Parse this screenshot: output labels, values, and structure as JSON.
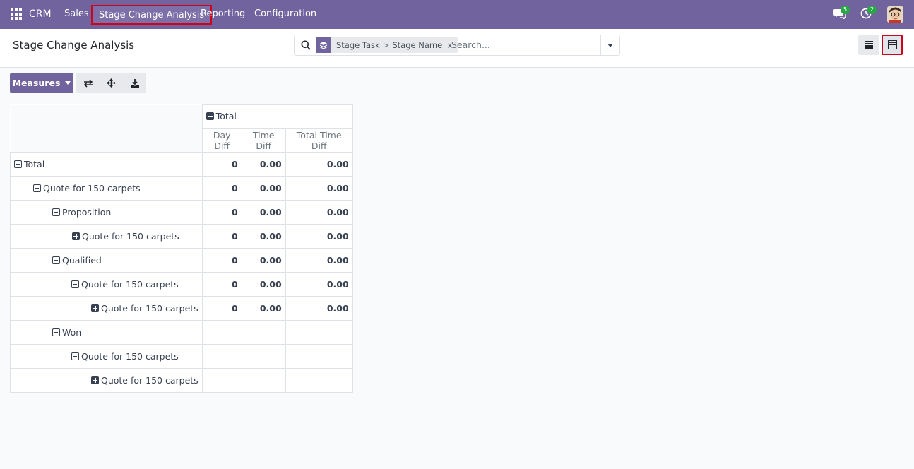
{
  "navbar": {
    "brand": "CRM",
    "menu": [
      "Sales",
      "Stage Change Analysis",
      "Reporting",
      "Configuration"
    ],
    "messages_badge": "5",
    "activities_badge": "2"
  },
  "control": {
    "title": "Stage Change Analysis",
    "facet": {
      "group": "Stage Task",
      "separator": ">",
      "value": "Stage Name",
      "remove": "×"
    },
    "search_placeholder": "Search..."
  },
  "toolbar": {
    "measures_label": "Measures"
  },
  "pivot": {
    "col_header": "Total",
    "measures": [
      "Day Diff",
      "Time Diff",
      "Total Time Diff"
    ],
    "rows": [
      {
        "label": "Total",
        "day": "0",
        "time": "0.00",
        "total": "0.00"
      },
      {
        "label": "Quote for 150 carpets",
        "day": "0",
        "time": "0.00",
        "total": "0.00"
      },
      {
        "label": "Proposition",
        "day": "0",
        "time": "0.00",
        "total": "0.00"
      },
      {
        "label": "Quote for 150 carpets",
        "day": "0",
        "time": "0.00",
        "total": "0.00"
      },
      {
        "label": "Qualified",
        "day": "0",
        "time": "0.00",
        "total": "0.00"
      },
      {
        "label": "Quote for 150 carpets",
        "day": "0",
        "time": "0.00",
        "total": "0.00"
      },
      {
        "label": "Quote for 150 carpets",
        "day": "0",
        "time": "0.00",
        "total": "0.00"
      },
      {
        "label": "Won",
        "day": "",
        "time": "",
        "total": ""
      },
      {
        "label": "Quote for 150 carpets",
        "day": "",
        "time": "",
        "total": ""
      },
      {
        "label": "Quote for 150 carpets",
        "day": "",
        "time": "",
        "total": ""
      }
    ]
  },
  "colors": {
    "navbar": "#71639e",
    "highlight": "#d0021b",
    "badge": "#28a745"
  }
}
